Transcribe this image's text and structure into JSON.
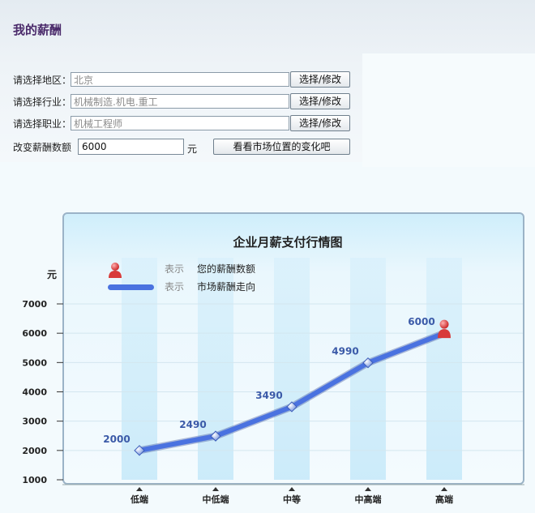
{
  "page": {
    "title": "我的薪酬"
  },
  "form": {
    "region": {
      "label": "请选择地区：",
      "value": "北京",
      "button": "选择/修改"
    },
    "industry": {
      "label": "请选择行业：",
      "value": "机械制造.机电.重工",
      "button": "选择/修改"
    },
    "occupation": {
      "label": "请选择职业：",
      "value": "机械工程师",
      "button": "选择/修改"
    },
    "salary": {
      "label": "改变薪酬数额",
      "value": "6000",
      "unit": "元",
      "button": "看看市场位置的变化吧"
    }
  },
  "legend": {
    "items": [
      {
        "prefix": "表示",
        "text": "您的薪酬数额",
        "icon": "person-icon"
      },
      {
        "prefix": "表示",
        "text": "市场薪酬走向",
        "icon": "line-swatch"
      }
    ]
  },
  "chart_data": {
    "type": "line",
    "title": "企业月薪支付行情图",
    "ylabel": "元",
    "xlabel": "",
    "categories": [
      "低端",
      "中低端",
      "中等",
      "中高端",
      "高端"
    ],
    "series": [
      {
        "values": [
          2000,
          2490,
          3490,
          4990,
          6000
        ]
      }
    ],
    "user_salary": {
      "category": "高端",
      "value": 6000
    },
    "yticks": [
      1000,
      2000,
      3000,
      4000,
      5000,
      6000,
      7000
    ],
    "ylim": [
      1000,
      7000
    ],
    "grid": true,
    "colors": {
      "line": "#4a72e0",
      "marker": "#d83a3a",
      "column": "#d6eef9"
    }
  }
}
